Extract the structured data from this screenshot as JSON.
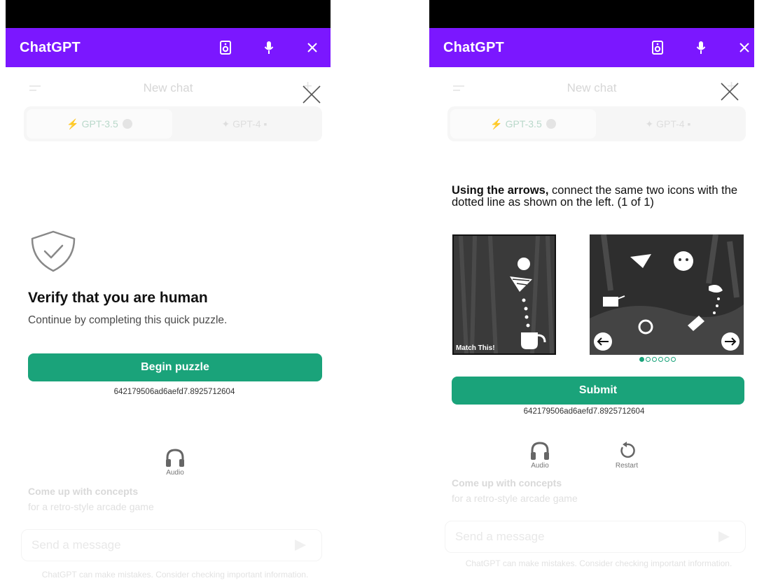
{
  "app_title": "ChatGPT",
  "background": {
    "header_title": "New chat",
    "models": [
      "GPT-3.5",
      "GPT-4"
    ],
    "suggestion_title": "Come up with concepts",
    "suggestion_sub": "for a retro-style arcade game",
    "message_placeholder": "Send a message",
    "disclaimer": "ChatGPT can make mistakes. Consider checking important information."
  },
  "left_screen": {
    "title": "Verify that you are human",
    "subtitle": "Continue by completing this quick puzzle.",
    "button": "Begin puzzle",
    "session_id": "642179506ad6aefd7.8925712604",
    "audio_label": "Audio"
  },
  "right_screen": {
    "instruction_bold": "Using the arrows,",
    "instruction_rest": " connect the same two icons with the dotted line as shown on the left. (1 of 1)",
    "reference_caption": "Match This!",
    "button": "Submit",
    "session_id": "642179506ad6aefd7.8925712604",
    "audio_label": "Audio",
    "restart_label": "Restart",
    "page_indicator": {
      "current": 1,
      "total": 6
    }
  },
  "colors": {
    "appbar": "#7b17ff",
    "accent": "#1aa37a",
    "statusbar": "#000000"
  },
  "icons": [
    "speaker-icon",
    "mic-icon",
    "close-icon",
    "shield-check-icon",
    "headphones-icon",
    "restart-icon",
    "arrow-left-icon",
    "arrow-right-icon"
  ]
}
